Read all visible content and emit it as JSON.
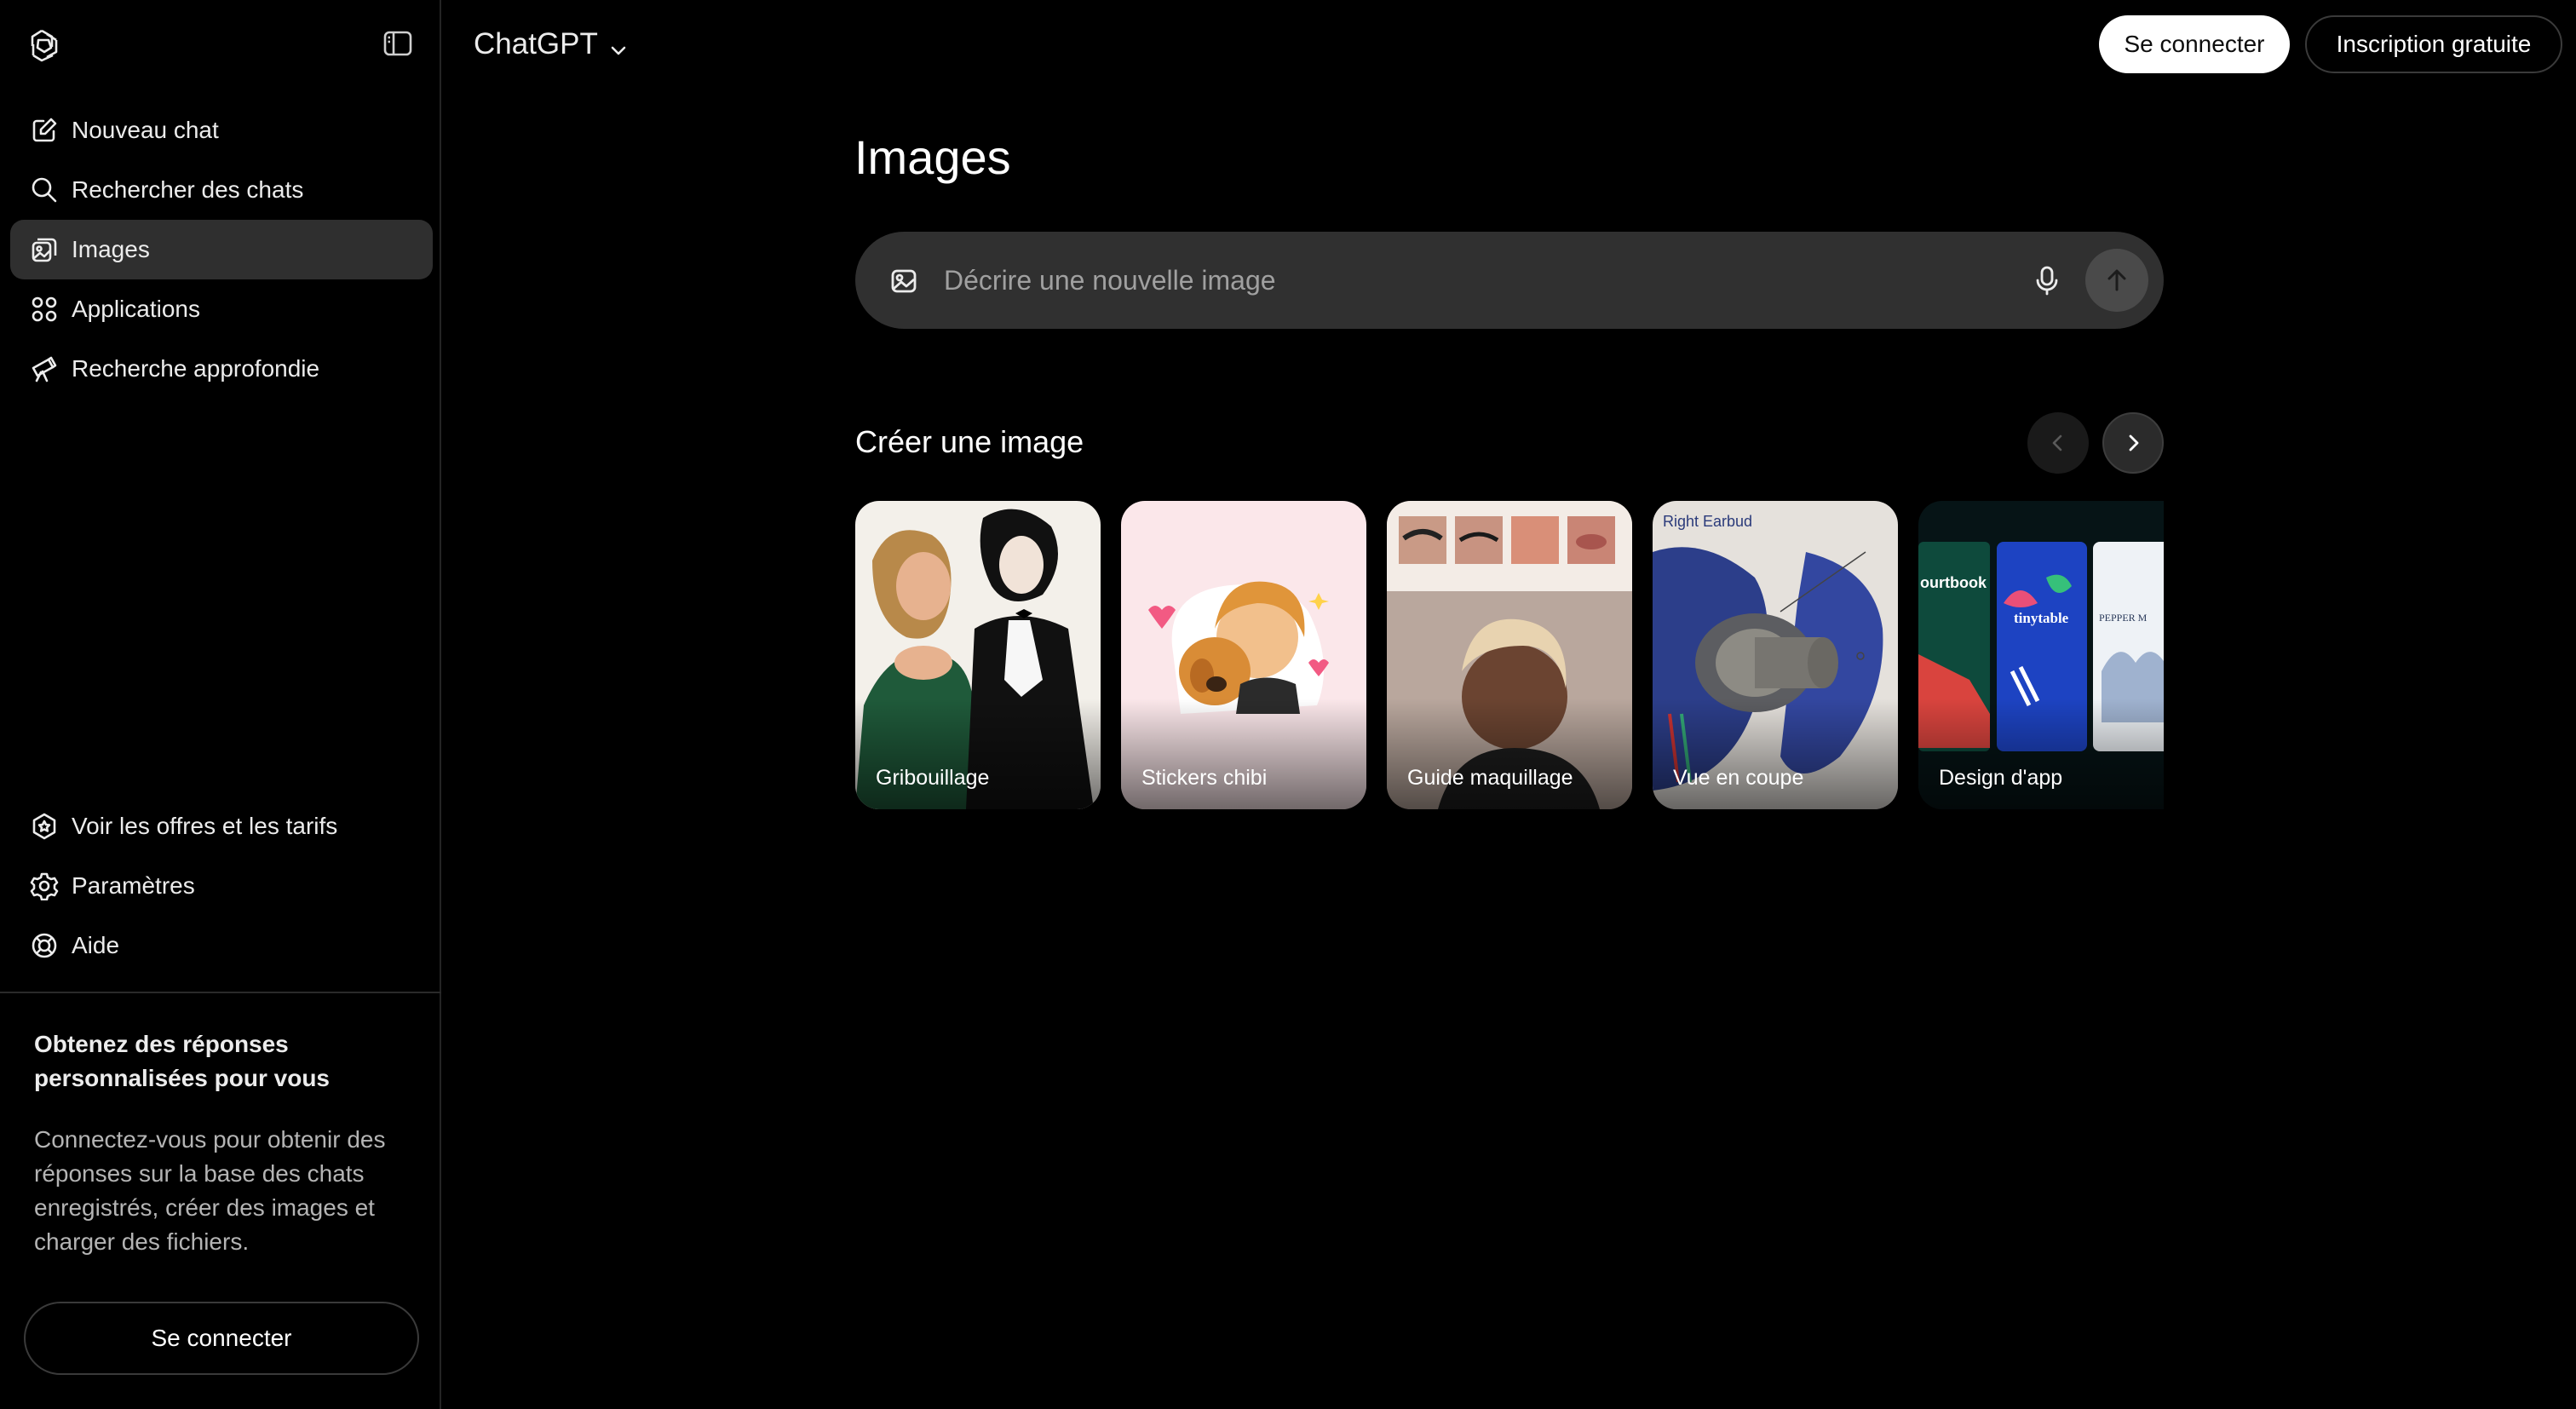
{
  "header": {
    "model_label": "ChatGPT",
    "login_label": "Se connecter",
    "signup_label": "Inscription gratuite"
  },
  "sidebar": {
    "items": [
      {
        "label": "Nouveau chat",
        "icon": "edit-icon"
      },
      {
        "label": "Rechercher des chats",
        "icon": "search-icon"
      },
      {
        "label": "Images",
        "icon": "images-icon",
        "active": true
      },
      {
        "label": "Applications",
        "icon": "apps-grid-icon"
      },
      {
        "label": "Recherche approfondie",
        "icon": "telescope-icon"
      }
    ],
    "bottom_items": [
      {
        "label": "Voir les offres et les tarifs",
        "icon": "plans-icon"
      },
      {
        "label": "Paramètres",
        "icon": "gear-icon"
      },
      {
        "label": "Aide",
        "icon": "help-lifebuoy-icon"
      }
    ],
    "promo": {
      "title": "Obtenez des réponses personnalisées pour vous",
      "text": "Connectez-vous pour obtenir des réponses sur la base des chats enregistrés, créer des images et charger des fichiers.",
      "button_label": "Se connecter"
    }
  },
  "main": {
    "title": "Images",
    "prompt": {
      "placeholder": "Décrire une nouvelle image"
    },
    "section_title": "Créer une image",
    "cards": [
      {
        "label": "Gribouillage"
      },
      {
        "label": "Stickers chibi"
      },
      {
        "label": "Guide maquillage"
      },
      {
        "label": "Vue en coupe",
        "image_text": "Right Earbud"
      },
      {
        "label": "Design d'app",
        "image_texts": [
          "ourtbook",
          "tinytable",
          "PEPPER M"
        ]
      }
    ]
  },
  "colors": {
    "background": "#000000",
    "sidebar_active": "#2f2f2f",
    "prompt_bg": "#303030",
    "text": "#ececec"
  }
}
